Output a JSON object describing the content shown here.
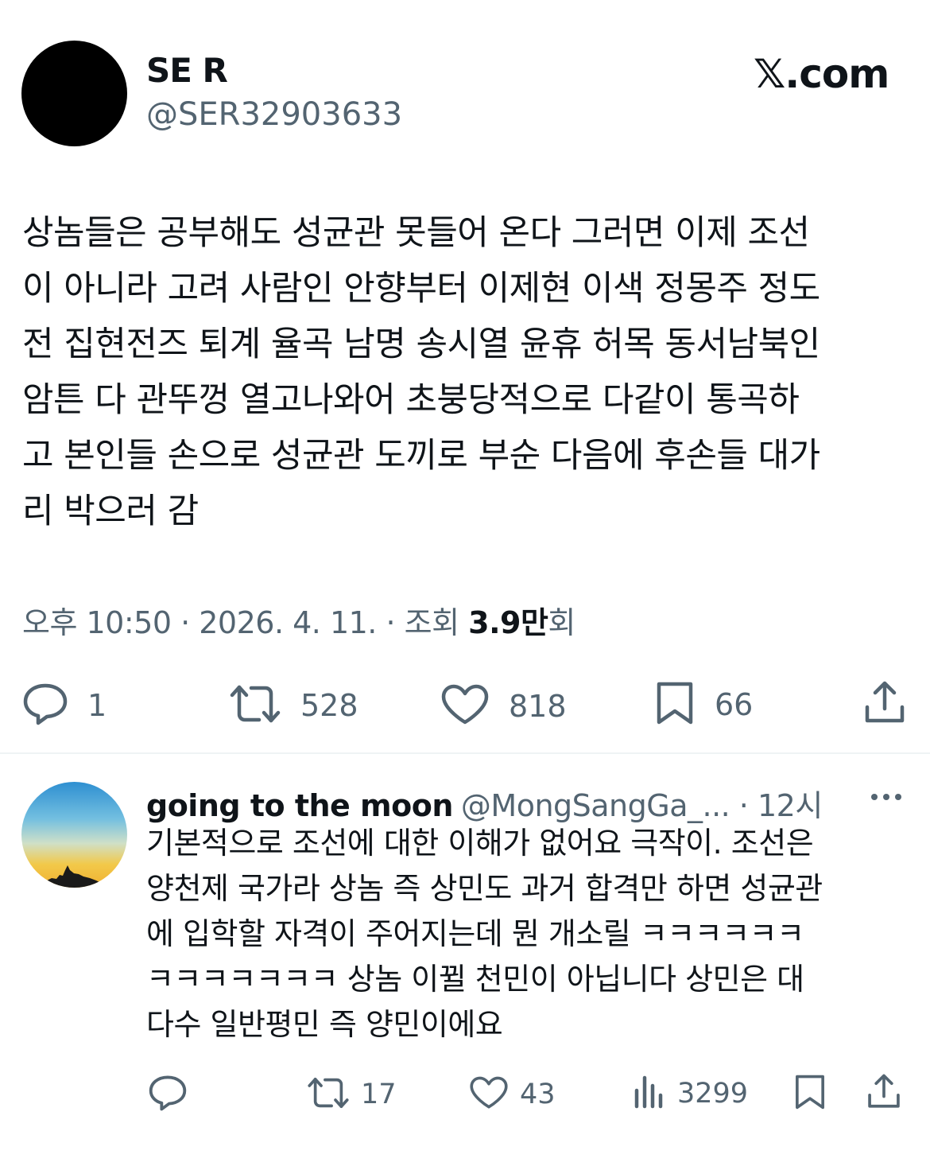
{
  "tweet": {
    "display_name": "SE R",
    "handle": "@SER32903633",
    "brand": "𝕏.com",
    "text": "상놈들은 공부해도 성균관 못들어 온다 그러면 이제 조선\n이 아니라 고려 사람인 안향부터 이제현 이색 정몽주 정도\n전 집현전즈 퇴계 율곡 남명 송시열 윤휴 허목 동서남북인\n암튼 다 관뚜껑 열고나와어 초붕당적으로 다같이 통곡하\n고 본인들 손으로 성균관 도끼로 부순 다음에 후손들 대가\n리 박으러 감",
    "time": "오후 10:50 · 2026. 4. 11. · 조회 ",
    "views_num": "3.9만",
    "views_suffix": "회",
    "replies": "1",
    "retweets": "528",
    "likes": "818",
    "bookmarks": "66",
    "icons": [
      "reply-icon",
      "retweet-icon",
      "heart-icon",
      "bookmark-icon",
      "share-icon"
    ]
  },
  "reply": {
    "display_name": "going to the moon",
    "handle": "@MongSangGa_... · 12시",
    "text": "기본적으로 조선에 대한 이해가 없어요 극작이. 조선은\n양천제 국가라 상놈 즉 상민도 과거 합격만 하면 성균관\n에 입학할 자격이 주어지는데  뭔 개소릴 ㅋㅋㅋㅋㅋㅋ\nㅋㅋㅋㅋㅋㅋㅋ 상놈 이뀔 천민이 아닙니다  상민은 대\n다수 일반평민 즉 양민이에요",
    "retweets": "17",
    "likes": "43",
    "views": "3299",
    "icons": [
      "reply-icon",
      "retweet-icon",
      "heart-icon",
      "views-icon",
      "bookmark-icon",
      "share-icon",
      "more-icon"
    ]
  },
  "colors": {
    "text": "#0f1419",
    "secondary": "#536471",
    "divider": "#eff3f4"
  }
}
